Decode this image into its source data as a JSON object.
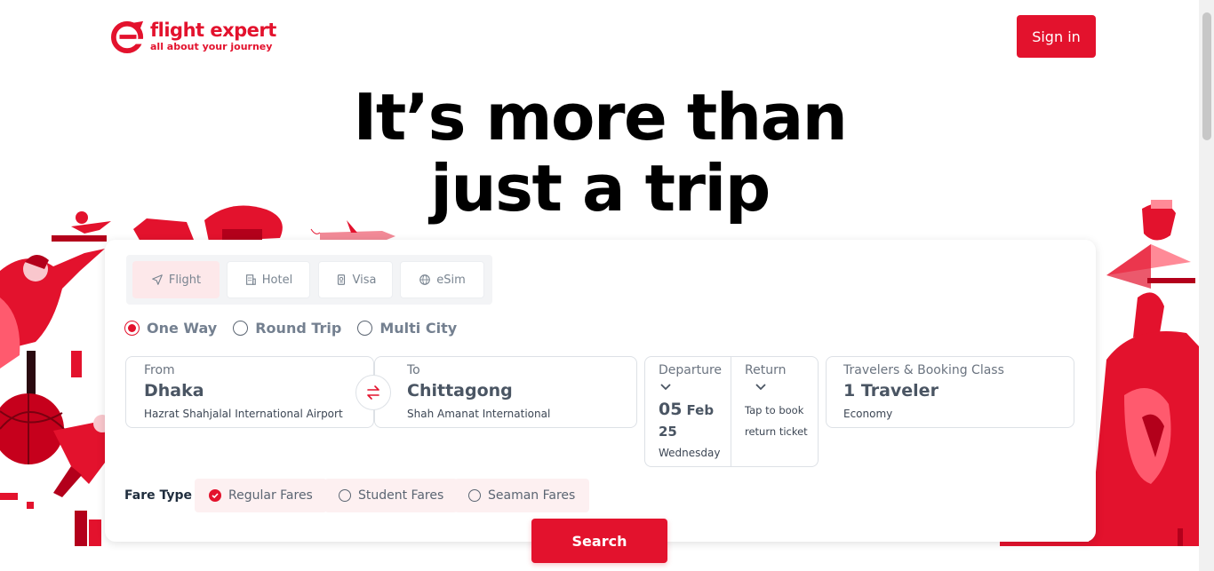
{
  "header": {
    "logo_name": "flight expert",
    "logo_tagline": "all about your journey",
    "signin_label": "Sign in"
  },
  "hero": {
    "title_line1": "It’s more than",
    "title_line2": "just a trip"
  },
  "tabs": [
    {
      "label": "Flight",
      "icon": "paper-plane-icon",
      "active": true
    },
    {
      "label": "Hotel",
      "icon": "building-icon",
      "active": false
    },
    {
      "label": "Visa",
      "icon": "passport-icon",
      "active": false
    },
    {
      "label": "eSim",
      "icon": "globe-icon",
      "active": false
    }
  ],
  "trip_types": [
    {
      "label": "One Way",
      "selected": true
    },
    {
      "label": "Round Trip",
      "selected": false
    },
    {
      "label": "Multi City",
      "selected": false
    }
  ],
  "from": {
    "label": "From",
    "city": "Dhaka",
    "airport": "Hazrat Shahjalal International Airport"
  },
  "to": {
    "label": "To",
    "city": "Chittagong",
    "airport": "Shah Amanat International"
  },
  "departure": {
    "label": "Departure",
    "day": "05",
    "month": "Feb",
    "year": "25",
    "weekday": "Wednesday"
  },
  "return": {
    "label": "Return",
    "hint_line1": "Tap to book",
    "hint_line2": "return ticket"
  },
  "travelers": {
    "label": "Travelers & Booking Class",
    "value": "1 Traveler",
    "class": "Economy"
  },
  "fare_type": {
    "label": "Fare Type :",
    "options": [
      {
        "label": "Regular Fares",
        "selected": true
      },
      {
        "label": "Student Fares",
        "selected": false
      },
      {
        "label": "Seaman Fares",
        "selected": false
      }
    ]
  },
  "search_label": "Search",
  "colors": {
    "brand": "#e3122d",
    "tab_active_bg": "#fde8ea",
    "fare_bg": "#fdf0f1"
  }
}
